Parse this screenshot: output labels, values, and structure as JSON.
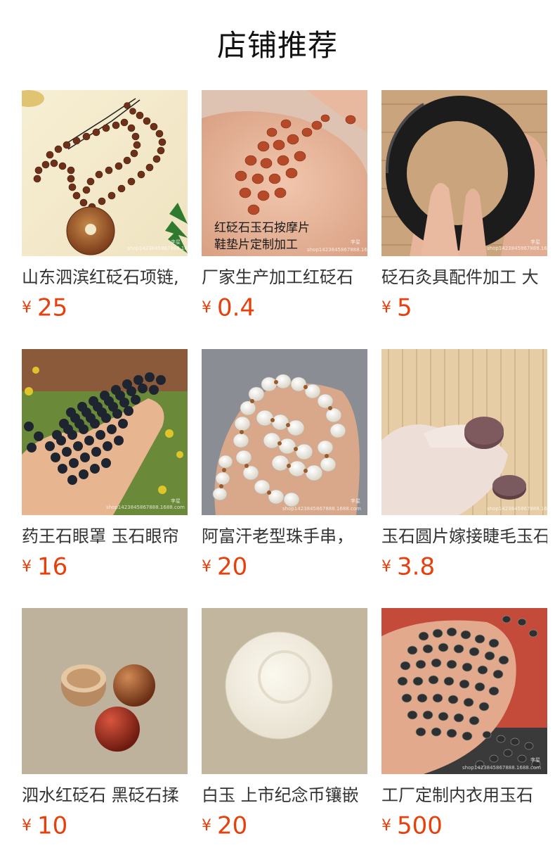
{
  "page": {
    "title": "店铺推荐"
  },
  "products": [
    {
      "name": "山东泗滨红砭石项链,",
      "currency": "¥",
      "price": "25",
      "image_icon": "necklace-photo"
    },
    {
      "name": "厂家生产加工红砭石",
      "currency": "¥",
      "price": "0.4",
      "image_icon": "red-stones-in-hand-photo",
      "image_caption": [
        "红砭石玉石按摩片",
        "鞋垫片定制加工"
      ]
    },
    {
      "name": "砭石灸具配件加工 大",
      "currency": "¥",
      "price": "5",
      "image_icon": "black-bangle-photo"
    },
    {
      "name": "药王石眼罩 玉石眼帘",
      "currency": "¥",
      "price": "16",
      "image_icon": "black-bead-mat-photo"
    },
    {
      "name": "阿富汗老型珠手串，",
      "currency": "¥",
      "price": "20",
      "image_icon": "white-bead-bracelet-photo"
    },
    {
      "name": "玉石圆片嫁接睫毛玉石",
      "currency": "¥",
      "price": "3.8",
      "image_icon": "stone-discs-photo"
    },
    {
      "name": "泗水红砭石 黑砭石揉",
      "currency": "¥",
      "price": "10",
      "image_icon": "stone-balls-photo"
    },
    {
      "name": "白玉 上市纪念币镶嵌",
      "currency": "¥",
      "price": "20",
      "image_icon": "white-jade-plate-photo"
    },
    {
      "name": "工厂定制内衣用玉石",
      "currency": "¥",
      "price": "500",
      "image_icon": "black-chips-photo"
    }
  ],
  "watermarks": {
    "shop_url": "shop1423845867888.1688.com",
    "brand": "李星"
  },
  "colors": {
    "price": "#e8400c",
    "title": "#111111",
    "name": "#333333"
  }
}
